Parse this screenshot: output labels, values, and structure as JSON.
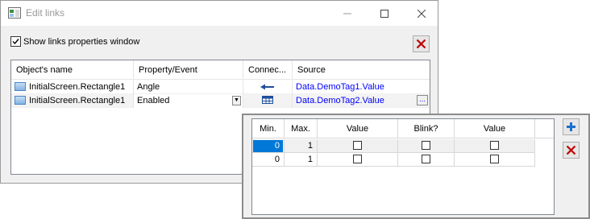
{
  "window": {
    "title": "Edit links"
  },
  "options": {
    "show_props_label": "Show links properties window",
    "show_props_checked": true
  },
  "grid": {
    "columns": [
      "Object's name",
      "Property/Event",
      "Connec...",
      "Source"
    ],
    "rows": [
      {
        "object": "InitialScreen.Rectangle1",
        "property": "Angle",
        "connection_icon": "arrow-left-icon",
        "source": "Data.DemoTag1.Value"
      },
      {
        "object": "InitialScreen.Rectangle1",
        "property": "Enabled",
        "connection_icon": "table-icon",
        "source": "Data.DemoTag2.Value",
        "selected": true
      }
    ]
  },
  "properties": {
    "columns": [
      "Min.",
      "Max.",
      "Value",
      "Blink?",
      "Value"
    ],
    "rows": [
      {
        "min": "0",
        "max": "1",
        "value_checked": false,
        "blink_checked": false,
        "value2_checked": false,
        "selected": true
      },
      {
        "min": "0",
        "max": "1",
        "value_checked": false,
        "blink_checked": false,
        "value2_checked": false
      }
    ]
  },
  "colors": {
    "link": "#0000ff",
    "selection": "#0078d7",
    "delete_red": "#c00000",
    "add_blue": "#1e6fc8"
  }
}
